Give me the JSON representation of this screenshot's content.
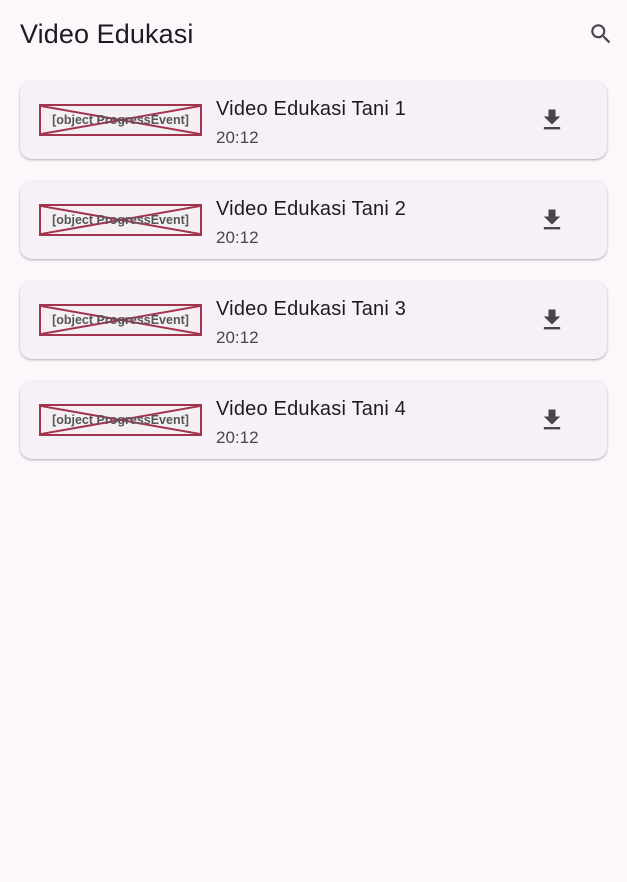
{
  "app_bar": {
    "title": "Video Edukasi",
    "search_icon": "search-icon"
  },
  "videos": [
    {
      "thumbnail_text": "[object ProgressEvent]",
      "title": "Video Edukasi Tani 1",
      "duration": "20:12",
      "action_icon": "download-icon"
    },
    {
      "thumbnail_text": "[object ProgressEvent]",
      "title": "Video Edukasi Tani 2",
      "duration": "20:12",
      "action_icon": "download-icon"
    },
    {
      "thumbnail_text": "[object ProgressEvent]",
      "title": "Video Edukasi Tani 3",
      "duration": "20:12",
      "action_icon": "download-icon"
    },
    {
      "thumbnail_text": "[object ProgressEvent]",
      "title": "Video Edukasi Tani 4",
      "duration": "20:12",
      "action_icon": "download-icon"
    }
  ],
  "colors": {
    "background": "#fdf7fc",
    "card": "#f5f1f7",
    "text_primary": "#1d1b20",
    "text_secondary": "#49454f",
    "broken_image_border": "#a3344f"
  }
}
